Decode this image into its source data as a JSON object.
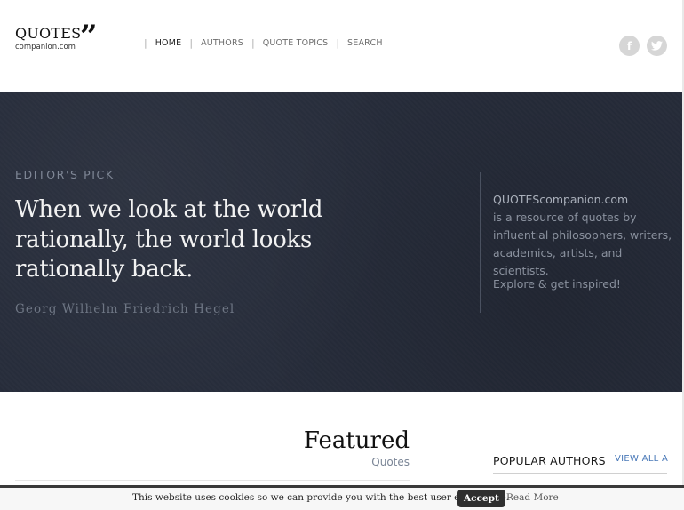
{
  "header": {
    "logo_text": "QUOTES",
    "logo_mark": "”",
    "logo_sub": "companion.com",
    "nav": [
      {
        "label": "HOME",
        "active": true
      },
      {
        "label": "AUTHORS",
        "active": false
      },
      {
        "label": "QUOTE TOPICS",
        "active": false
      },
      {
        "label": "SEARCH",
        "active": false
      }
    ],
    "social": [
      {
        "icon": "facebook-icon",
        "glyph": "f"
      },
      {
        "icon": "twitter-icon",
        "glyph": "•"
      }
    ]
  },
  "hero": {
    "eyebrow": "EDITOR'S PICK",
    "quote": "When we look at the world rationally, the world looks rationally back.",
    "author": "Georg Wilhelm Friedrich Hegel",
    "about_site": "QUOTEScompanion.com",
    "about_body": "is a resource of quotes by influential philosophers, writers, academics, artists, and scientists.",
    "about_cta": "Explore & get inspired!"
  },
  "featured": {
    "title": "Featured",
    "subtitle": "Quotes"
  },
  "popular": {
    "title": "POPULAR AUTHORS",
    "view_all": "VIEW ALL AUTHORS"
  },
  "cookie": {
    "text": "This website uses cookies so we can provide you with the best user experience.",
    "accept": "Accept",
    "more": "Read More"
  },
  "colors": {
    "hero_bg": "#272d3b",
    "link_blue": "#4a79b8",
    "social_gray": "#d6d6d6"
  }
}
